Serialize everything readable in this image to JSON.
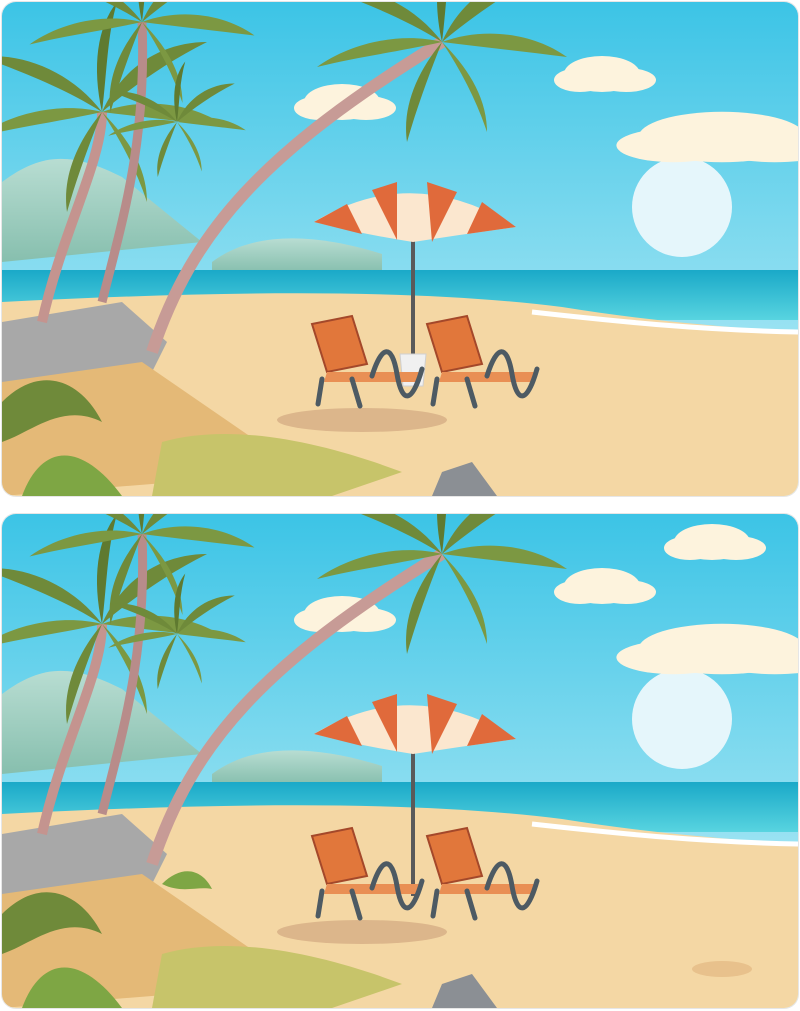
{
  "game": {
    "type": "spot-the-difference",
    "panels": [
      {
        "id": "top",
        "shows_umbrella_bucket": true,
        "shows_extra_cloud": false,
        "shows_extra_bush": false,
        "shows_sand_mound": false
      },
      {
        "id": "bottom",
        "shows_umbrella_bucket": false,
        "shows_extra_cloud": true,
        "shows_extra_bush": true,
        "shows_sand_mound": true
      }
    ]
  },
  "palette": {
    "sky_top": "#3cc4e6",
    "sky_bottom": "#b8ecf7",
    "sea": "#1fb4cf",
    "sand": "#f4d7a4",
    "palm_leaf": "#6f8a3a",
    "umbrella_red": "#e06a3b",
    "umbrella_cream": "#fbe7cf",
    "chair": "#e1773b"
  },
  "icons": [
    "palm-tree-icon",
    "beach-umbrella-icon",
    "sun-lounger-icon",
    "cloud-icon",
    "rock-icon"
  ]
}
